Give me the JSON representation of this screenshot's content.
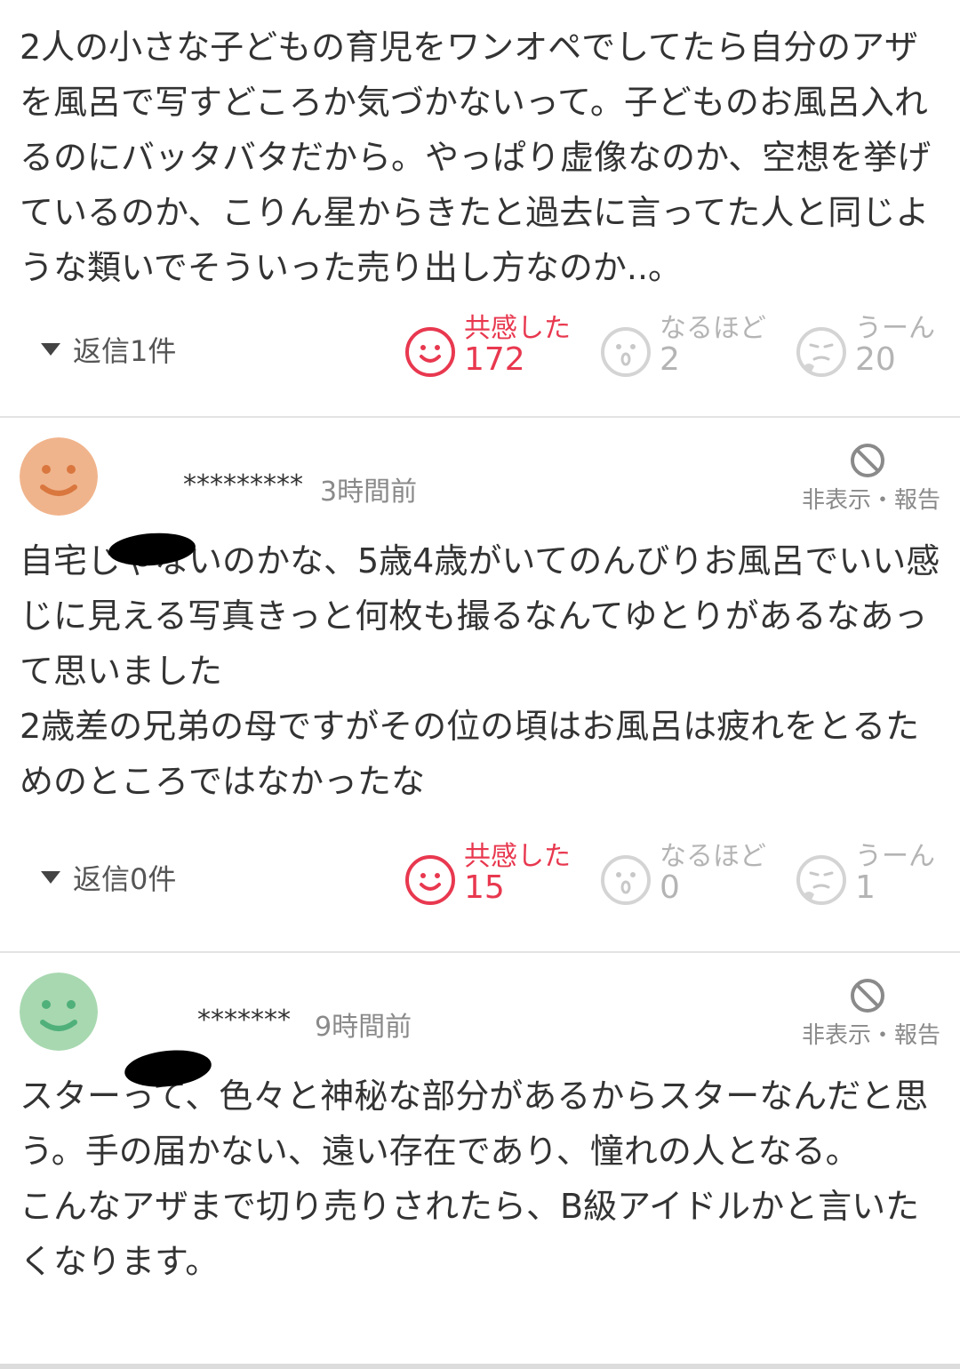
{
  "comments": [
    {
      "body": "2人の小さな子どもの育児をワンオペでしてたら自分のアザを風呂で写すどころか気づかないって。子どものお風呂入れるのにバッタバタだから。やっぱり虚像なのか、空想を挙げているのか、こりん星からきたと過去に言ってた人と同じような類いでそういった売り出し方なのか..。",
      "reply_label": "返信1件",
      "reactions": {
        "empathy": {
          "label": "共感した",
          "count": "172"
        },
        "naruhodo": {
          "label": "なるほど",
          "count": "2"
        },
        "uun": {
          "label": "うーん",
          "count": "20"
        }
      }
    },
    {
      "user_id": "*********",
      "time": "3時間前",
      "hide_label": "非表示・報告",
      "avatar_color": "#f0b48c",
      "body": "自宅じゃないのかな、5歳4歳がいてのんびりお風呂でいい感じに見える写真きっと何枚も撮るなんてゆとりがあるなあって思いました\n2歳差の兄弟の母ですがその位の頃はお風呂は疲れをとるためのところではなかったな",
      "reply_label": "返信0件",
      "reactions": {
        "empathy": {
          "label": "共感した",
          "count": "15"
        },
        "naruhodo": {
          "label": "なるほど",
          "count": "0"
        },
        "uun": {
          "label": "うーん",
          "count": "1"
        }
      }
    },
    {
      "user_id": "*******",
      "time": "9時間前",
      "hide_label": "非表示・報告",
      "avatar_color": "#a8d8b0",
      "body": "スターって、色々と神秘な部分があるからスターなんだと思う。手の届かない、遠い存在であり、憧れの人となる。\nこんなアザまで切り売りされたら、B級アイドルかと言いたくなります。"
    }
  ],
  "colors": {
    "empathy": "#e8384f",
    "muted": "#b4b4b4"
  }
}
